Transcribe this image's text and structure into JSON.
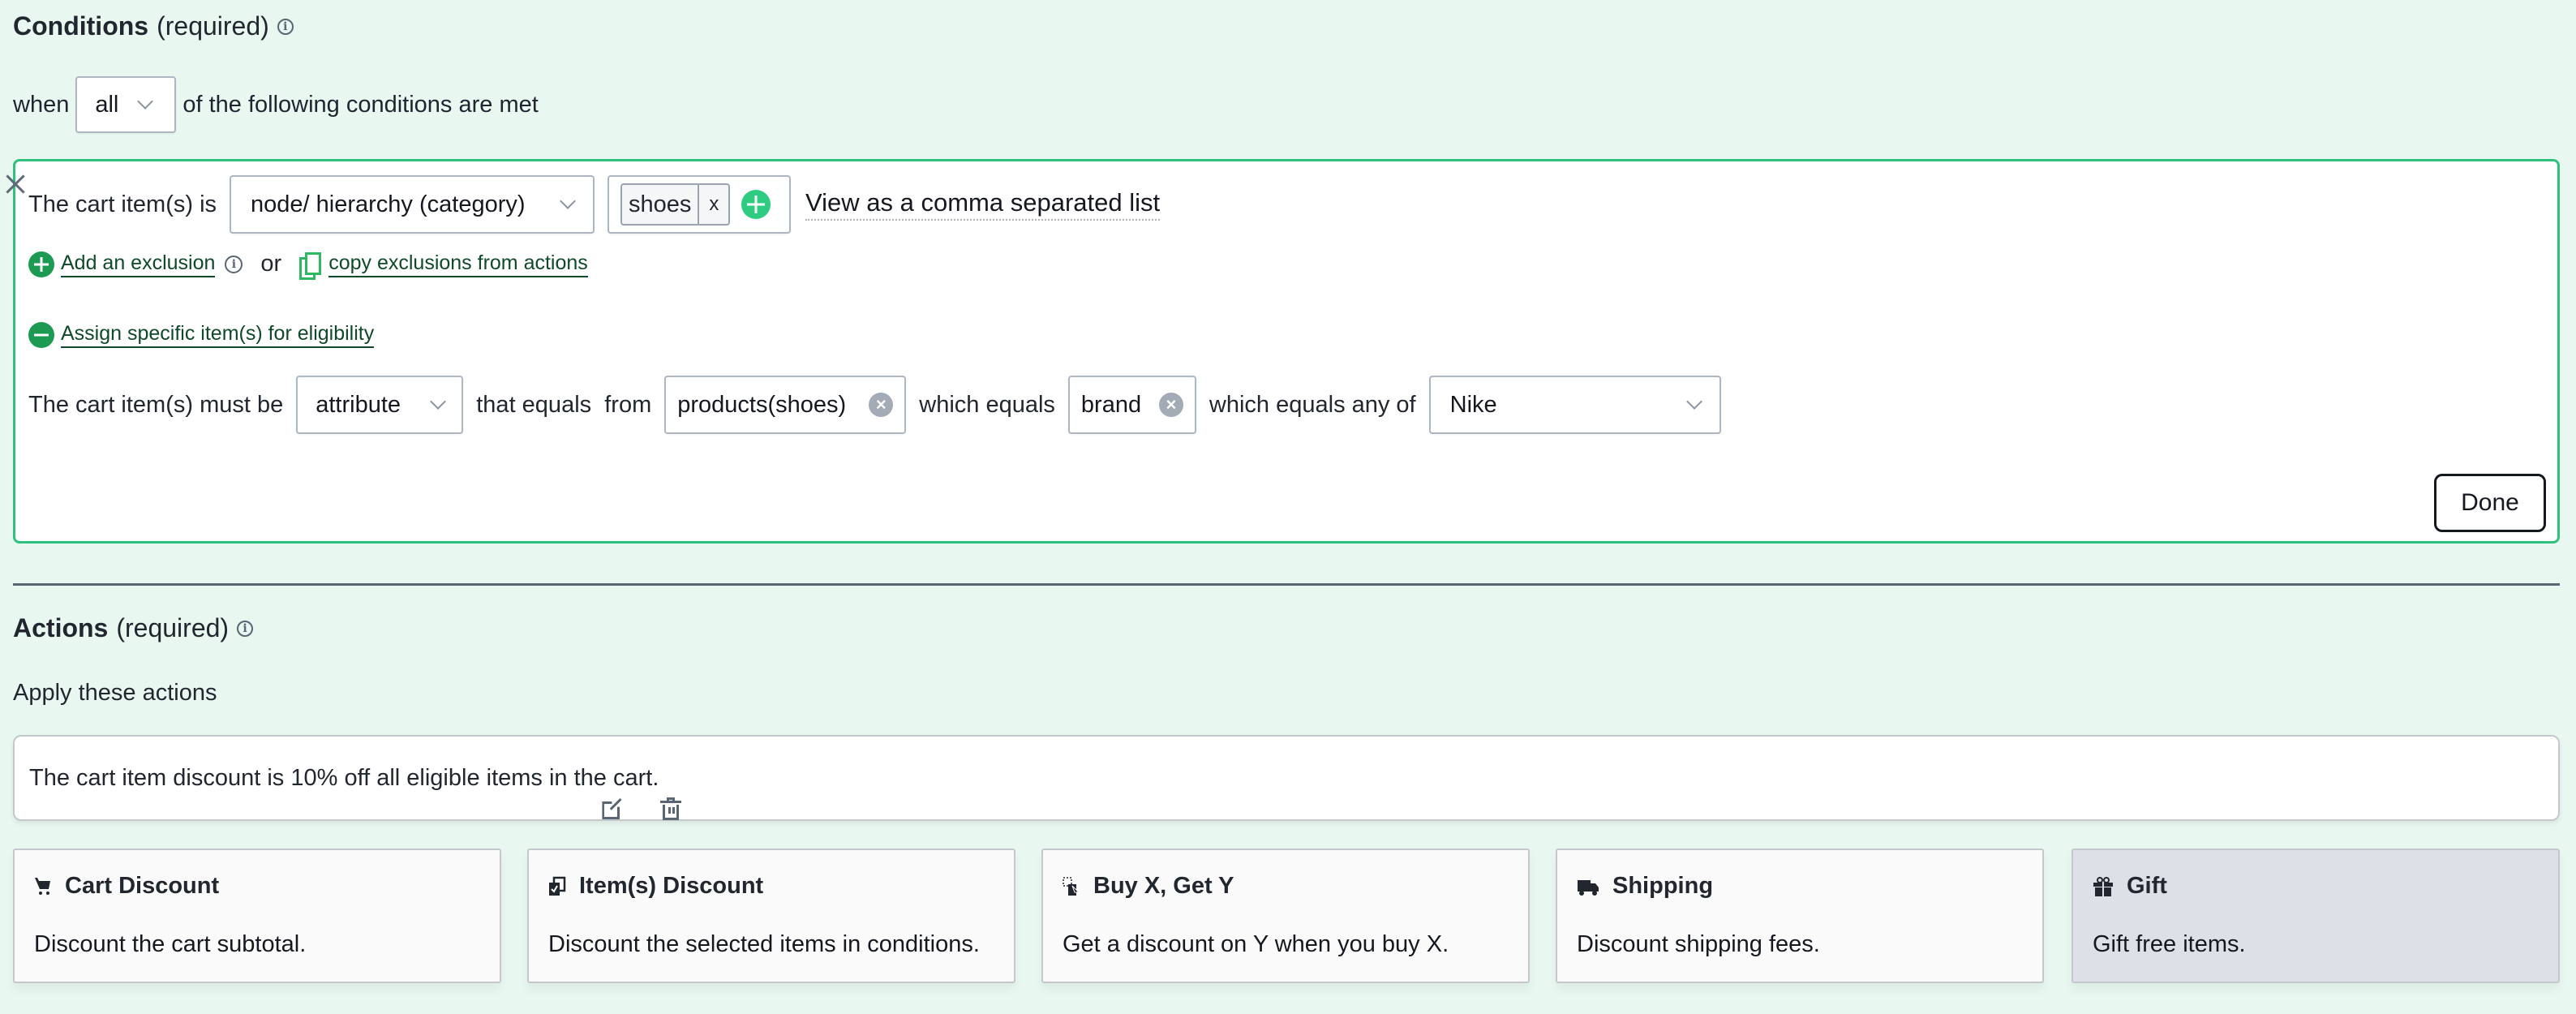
{
  "conditions": {
    "title": "Conditions",
    "required_label": "(required)",
    "when_prefix": "when",
    "match_mode": "all",
    "when_suffix": "of the following conditions are met",
    "rule": {
      "item_label": "The cart item(s) is",
      "item_type": "node/ hierarchy (category)",
      "tags": [
        "shoes"
      ],
      "tag_remove_label": "x",
      "view_list_link": "View as a comma separated list",
      "add_exclusion_link": "Add an exclusion",
      "or_label": "or",
      "copy_exclusions_link": "copy exclusions from actions",
      "assign_link": "Assign specific item(s) for eligibility",
      "eligibility": {
        "must_be_label": "The cart item(s) must be",
        "qualifier": "attribute",
        "that_equals_label": "that equals  from",
        "source": "products(shoes)",
        "which_equals_label": "which equals",
        "attribute": "brand",
        "any_of_label": "which equals any of",
        "value": "Nike"
      },
      "done_label": "Done"
    }
  },
  "actions": {
    "title": "Actions",
    "required_label": "(required)",
    "subtitle": "Apply these actions",
    "existing_action": "The cart item discount is 10% off all eligible items in the cart.",
    "types": [
      {
        "icon": "cart-icon",
        "title": "Cart Discount",
        "desc": "Discount the cart subtotal.",
        "selected": false
      },
      {
        "icon": "items-check-icon",
        "title": "Item(s) Discount",
        "desc": "Discount the selected items in conditions.",
        "selected": false
      },
      {
        "icon": "buy-get-icon",
        "title": "Buy X, Get Y",
        "desc": "Get a discount on Y when you buy X.",
        "selected": false
      },
      {
        "icon": "truck-icon",
        "title": "Shipping",
        "desc": "Discount shipping fees.",
        "selected": false
      },
      {
        "icon": "gift-icon",
        "title": "Gift",
        "desc": "Gift free items.",
        "selected": true
      }
    ]
  },
  "colors": {
    "background": "#e8f8f0",
    "accent_green": "#2ec27e",
    "link_green": "#0e4a2a",
    "selected_card": "#dde0e7"
  }
}
